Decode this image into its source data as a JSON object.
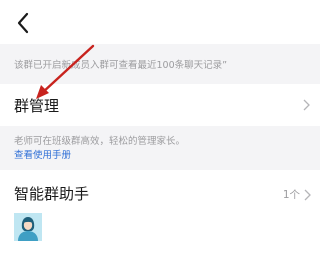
{
  "notice": {
    "text": "该群已开启新成员入群可查看最近100条聊天记录”"
  },
  "group_management": {
    "title": "群管理",
    "description": "老师可在班级群高效，轻松的管理家长。",
    "manual_link": "查看使用手册"
  },
  "assistant": {
    "title": "智能群助手",
    "count": "1个"
  },
  "colors": {
    "background": "#f4f4f6",
    "link": "#2f6fd6",
    "secondary_text": "#9c9c9f",
    "annotation_arrow": "#c8231e"
  },
  "icons": {
    "back": "back-arrow-icon",
    "chevron": "chevron-right-icon",
    "avatar": "teacher-avatar"
  }
}
